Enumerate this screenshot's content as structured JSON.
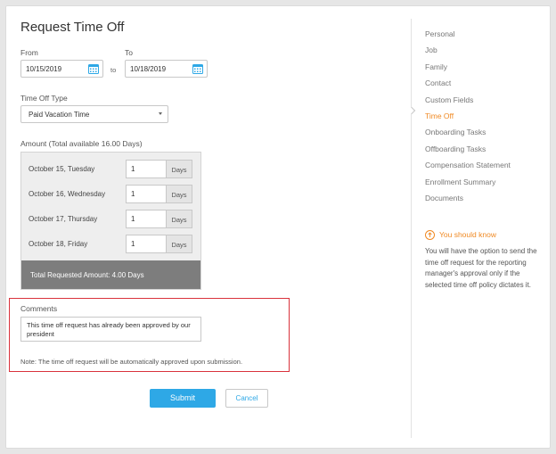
{
  "page": {
    "title": "Request Time Off"
  },
  "dates": {
    "from_label": "From",
    "to_label": "To",
    "from_value": "10/15/2019",
    "to_value": "10/18/2019",
    "separator": "to"
  },
  "time_off_type": {
    "label": "Time Off Type",
    "selected": "Paid Vacation Time"
  },
  "amount": {
    "label": "Amount (Total available 16.00 Days)",
    "rows": [
      {
        "day": "October 15, Tuesday",
        "value": "1",
        "unit": "Days"
      },
      {
        "day": "October 16, Wednesday",
        "value": "1",
        "unit": "Days"
      },
      {
        "day": "October 17, Thursday",
        "value": "1",
        "unit": "Days"
      },
      {
        "day": "October 18, Friday",
        "value": "1",
        "unit": "Days"
      }
    ],
    "total": "Total Requested Amount: 4.00 Days"
  },
  "comments": {
    "label": "Comments",
    "value": "This time off request has already been approved by our president",
    "note": "Note: The time off request will be automatically approved upon submission."
  },
  "actions": {
    "submit": "Submit",
    "cancel": "Cancel"
  },
  "sidebar": {
    "items": [
      {
        "label": "Personal"
      },
      {
        "label": "Job"
      },
      {
        "label": "Family"
      },
      {
        "label": "Contact"
      },
      {
        "label": "Custom Fields"
      },
      {
        "label": "Time Off",
        "active": true
      },
      {
        "label": "Onboarding Tasks"
      },
      {
        "label": "Offboarding Tasks"
      },
      {
        "label": "Compensation Statement"
      },
      {
        "label": "Enrollment Summary"
      },
      {
        "label": "Documents"
      }
    ],
    "info": {
      "title": "You should know",
      "icon": "arrow-up-circle-icon",
      "text": "You will have the option to send the time off request for the reporting manager's approval only if the selected time off policy dictates it."
    }
  },
  "colors": {
    "accent": "#2ea8e6",
    "orange": "#f08a24",
    "highlight_border": "#d9323c",
    "total_bar": "#7d7d7d"
  }
}
